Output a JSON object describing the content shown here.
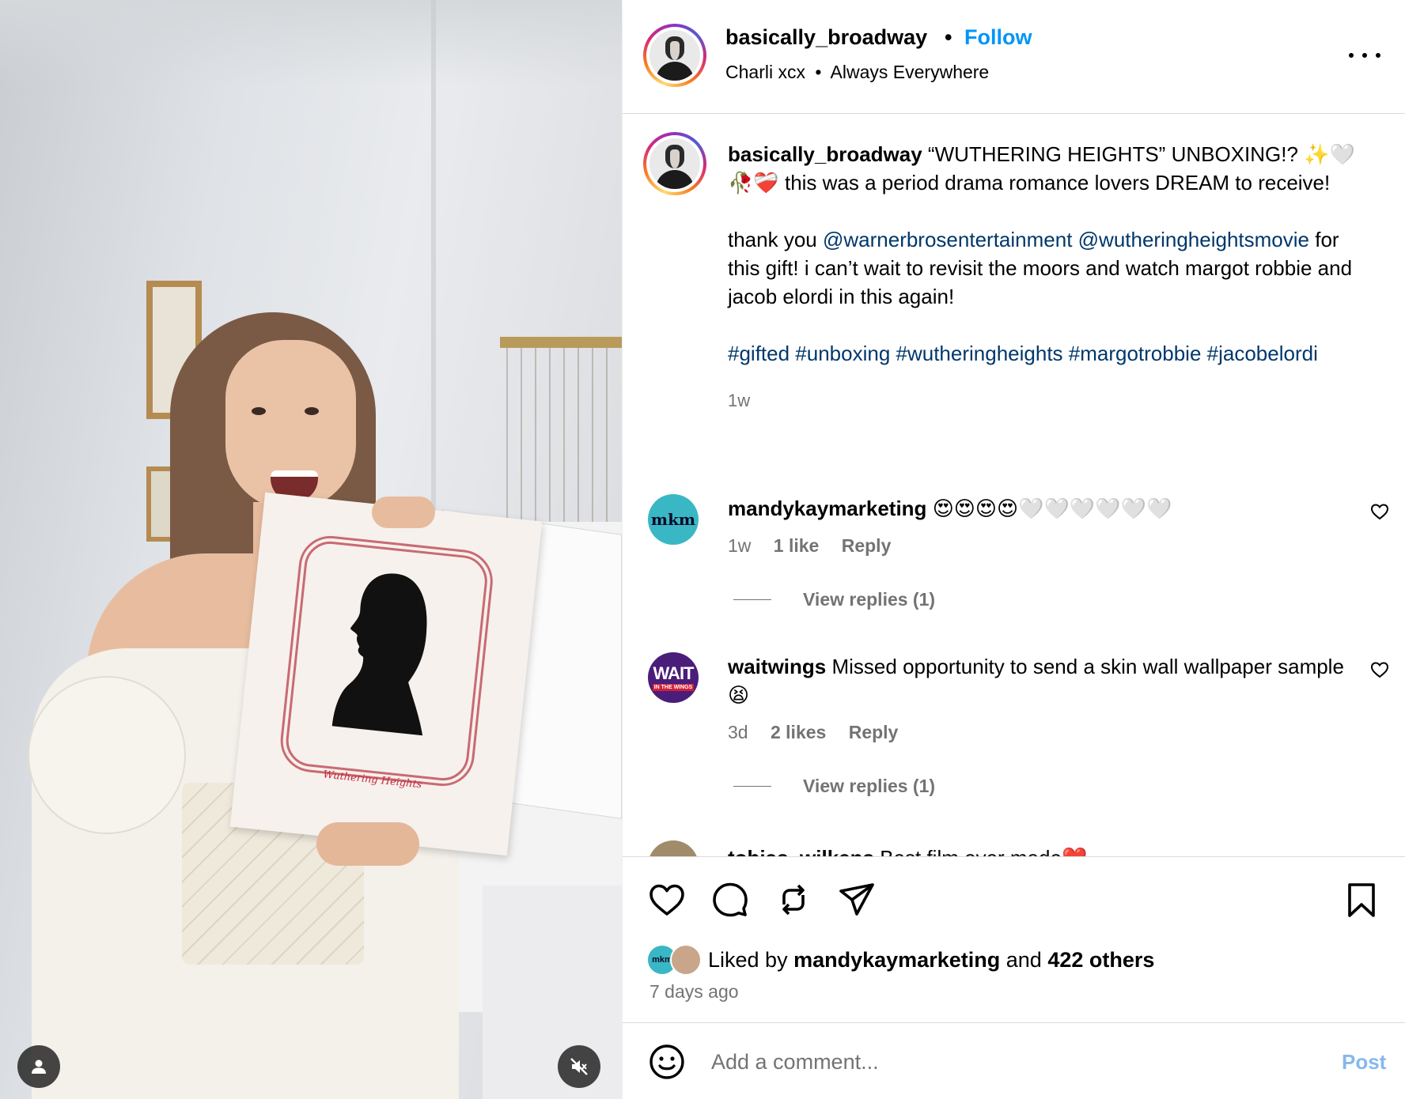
{
  "post": {
    "username": "basically_broadway",
    "follow_label": "Follow",
    "separator": "•",
    "audio_artist": "Charli xcx",
    "audio_title": "Always Everywhere",
    "card_title": "Wuthering Heights"
  },
  "caption": {
    "username": "basically_broadway",
    "line1": "“WUTHERING HEIGHTS” UNBOXING!? ✨🤍🥀❤️‍🩹 this was a period drama romance lovers DREAM to receive!",
    "thanks_prefix": "thank you",
    "mention1": "@warnerbrosentertainment",
    "mention2": "@wutheringheightsmovie",
    "thanks_rest": "for this gift! i can’t wait to revisit the moors and watch margot robbie and jacob elordi in this again!",
    "hashtags": "#gifted #unboxing #wutheringheights #margotrobbie #jacobelordi",
    "time": "1w"
  },
  "comments": [
    {
      "avatar_text": "mkm",
      "username": "mandykaymarketing",
      "text": "😍😍😍😍🤍🤍🤍🤍🤍🤍",
      "time": "1w",
      "likes": "1 like",
      "reply": "Reply",
      "view_replies": "View replies (1)"
    },
    {
      "avatar_text": "WAIT",
      "avatar_sub": "IN THE WINGS",
      "username": "waitwings",
      "text": "Missed opportunity to send a skin wall wallpaper sample 😫",
      "time": "3d",
      "likes": "2 likes",
      "reply": "Reply",
      "view_replies": "View replies (1)"
    },
    {
      "username": "tobias_wilkens",
      "text": "Best film ever made❤️"
    }
  ],
  "liked": {
    "prefix": "Liked by",
    "user": "mandykaymarketing",
    "and": "and",
    "others": "422 others",
    "mini_avatar_text": "mkm"
  },
  "posted_ago": "7 days ago",
  "composer": {
    "placeholder": "Add a comment...",
    "post_label": "Post"
  },
  "colors": {
    "accent": "#0095f6",
    "link": "#00376b",
    "muted": "#737373",
    "post_disabled": "#85b8ee"
  }
}
